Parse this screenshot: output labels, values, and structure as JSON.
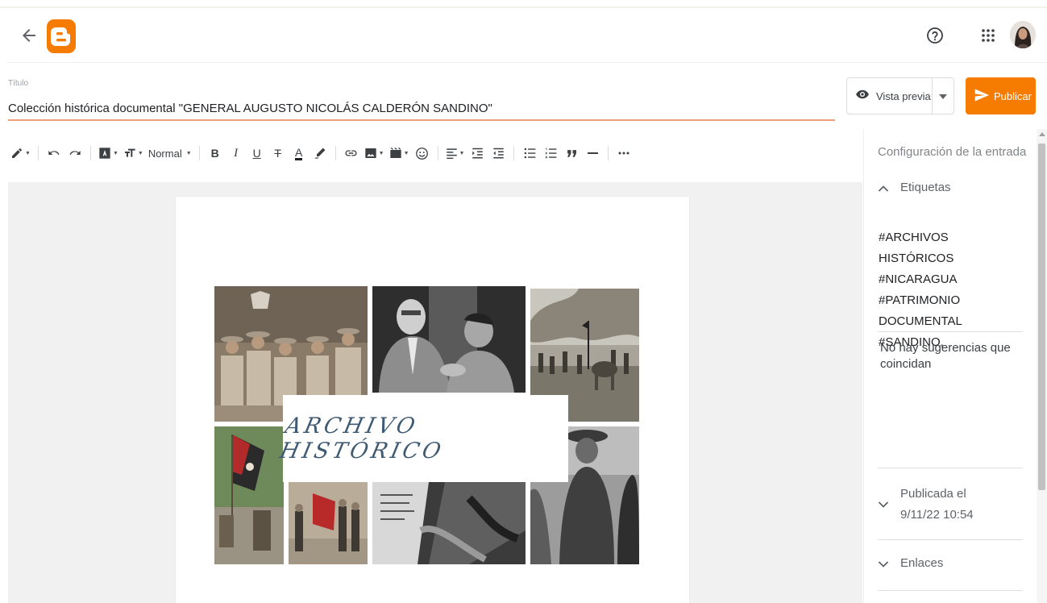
{
  "header": {
    "colors": {
      "brand": "#f57c00"
    }
  },
  "post": {
    "title_label": "Título",
    "title_value": "Colección histórica documental \"GENERAL AUGUSTO NICOLÁS CALDERÓN SANDINO\""
  },
  "actions": {
    "preview_label": "Vista previa",
    "publish_label": "Publicar"
  },
  "toolbar": {
    "paragraph_style": "Normal"
  },
  "content": {
    "banner_text": "ARCHIVO HISTÓRICO"
  },
  "sidebar": {
    "title": "Configuración de la entrada",
    "labels_section": "Etiquetas",
    "tags": [
      "#ARCHIVOS HISTÓRICOS",
      "#NICARAGUA",
      "#PATRIMONIO",
      "DOCUMENTAL #SANDINO,"
    ],
    "no_suggestions": "No hay sugerencias que coincidan",
    "published_label": "Publicada el",
    "published_date": "9/11/22 10:54",
    "links_section": "Enlaces"
  }
}
